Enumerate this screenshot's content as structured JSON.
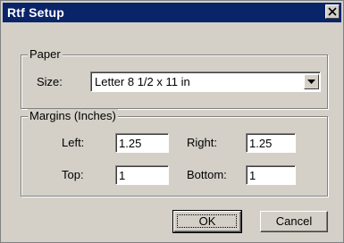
{
  "window": {
    "title": "Rtf Setup",
    "close_icon": "close-x-icon"
  },
  "paper": {
    "group_label": "Paper",
    "size_label": "Size:",
    "size_value": "Letter 8 1/2 x 11 in"
  },
  "margins": {
    "group_label": "Margins (Inches)",
    "left_label": "Left:",
    "left_value": "1.25",
    "right_label": "Right:",
    "right_value": "1.25",
    "top_label": "Top:",
    "top_value": "1",
    "bottom_label": "Bottom:",
    "bottom_value": "1"
  },
  "buttons": {
    "ok_label": "OK",
    "cancel_label": "Cancel"
  },
  "colors": {
    "titlebar": "#0a246a",
    "face": "#d4d0c8"
  }
}
